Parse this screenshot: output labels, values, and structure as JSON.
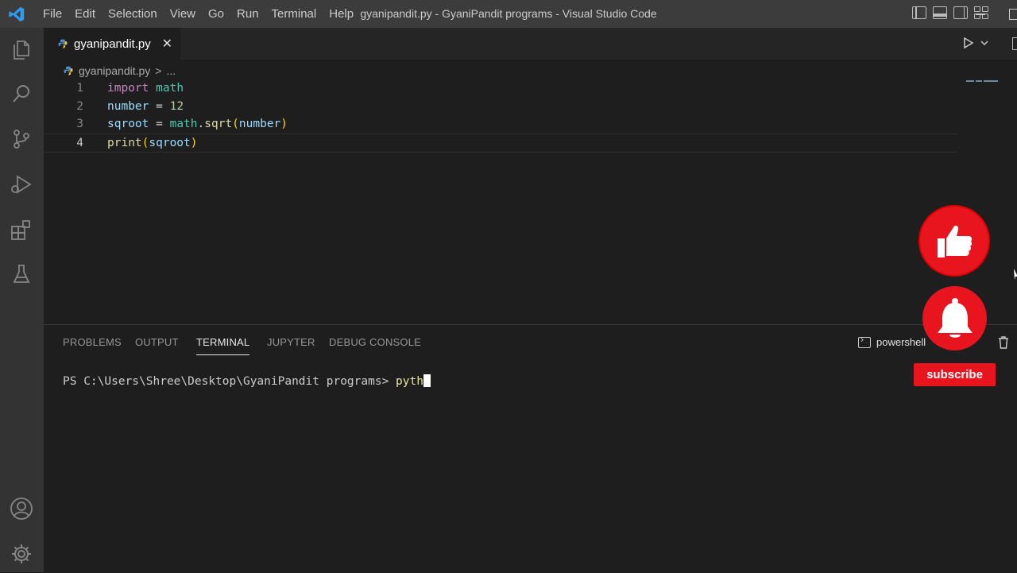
{
  "titlebar": {
    "menu": [
      "File",
      "Edit",
      "Selection",
      "View",
      "Go",
      "Run",
      "Terminal",
      "Help"
    ],
    "window_title": "gyanipandit.py - GyaniPandit programs - Visual Studio Code"
  },
  "activity_bar": {
    "items": [
      "files-icon",
      "search-icon",
      "source-control-icon",
      "run-debug-icon",
      "extensions-icon",
      "testing-icon"
    ],
    "bottom": [
      "account-icon",
      "settings-gear-icon"
    ]
  },
  "editor": {
    "tab": {
      "name": "gyanipandit.py",
      "close": "✕"
    },
    "breadcrumb": {
      "file": "gyanipandit.py",
      "sep": ">",
      "more": "..."
    },
    "lines": [
      {
        "num": "1",
        "tokens": [
          {
            "t": "import",
            "c": "kw"
          },
          {
            "t": " ",
            "c": "plain"
          },
          {
            "t": "math",
            "c": "mod"
          }
        ]
      },
      {
        "num": "2",
        "tokens": [
          {
            "t": "number",
            "c": "var"
          },
          {
            "t": " = ",
            "c": "plain"
          },
          {
            "t": "12",
            "c": "num"
          }
        ]
      },
      {
        "num": "3",
        "tokens": [
          {
            "t": "sqroot",
            "c": "var"
          },
          {
            "t": " = ",
            "c": "plain"
          },
          {
            "t": "math",
            "c": "mod"
          },
          {
            "t": ".",
            "c": "plain"
          },
          {
            "t": "sqrt",
            "c": "fn"
          },
          {
            "t": "(",
            "c": "pn"
          },
          {
            "t": "number",
            "c": "var"
          },
          {
            "t": ")",
            "c": "pn"
          }
        ]
      },
      {
        "num": "4",
        "tokens": [
          {
            "t": "print",
            "c": "fn"
          },
          {
            "t": "(",
            "c": "pn"
          },
          {
            "t": "sqroot",
            "c": "var"
          },
          {
            "t": ")",
            "c": "pn"
          }
        ]
      }
    ],
    "active_line": "4"
  },
  "panel": {
    "tabs": [
      "PROBLEMS",
      "OUTPUT",
      "TERMINAL",
      "JUPYTER",
      "DEBUG CONSOLE"
    ],
    "active_tab": "TERMINAL",
    "shell": "powershell",
    "terminal": {
      "prompt": "PS C:\\Users\\Shree\\Desktop\\GyaniPandit programs> ",
      "typed": "pyth"
    }
  },
  "overlay": {
    "subscribe_label": "subscribe"
  },
  "colors": {
    "accent_red": "#e8141e",
    "editor_bg": "#1e1e1e",
    "activity_bg": "#333333",
    "titlebar_bg": "#3c3c3c"
  }
}
